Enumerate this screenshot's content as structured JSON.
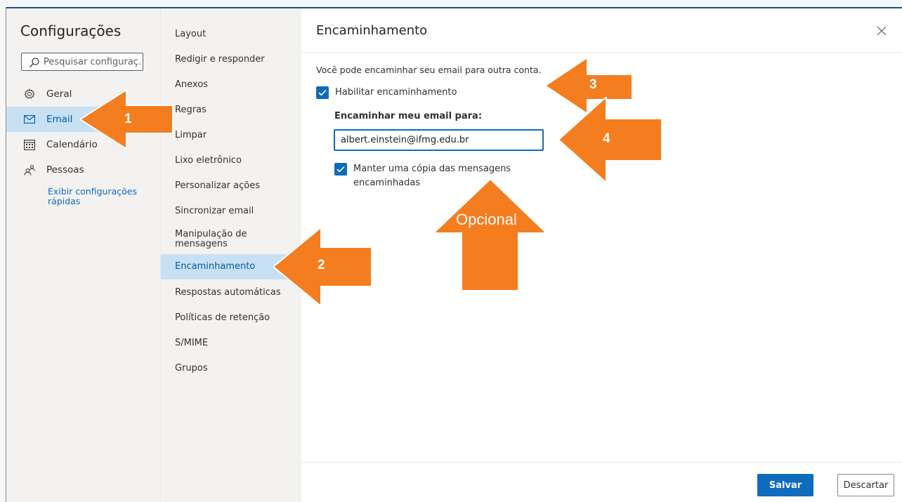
{
  "sidebar": {
    "title": "Configurações",
    "search_placeholder": "Pesquisar configuraç...",
    "items": [
      {
        "label": "Geral",
        "icon": "gear-icon"
      },
      {
        "label": "Email",
        "icon": "mail-icon",
        "active": true
      },
      {
        "label": "Calendário",
        "icon": "calendar-icon"
      },
      {
        "label": "Pessoas",
        "icon": "people-icon"
      }
    ],
    "quick_settings": "Exibir configurações rápidas"
  },
  "submenu": {
    "items": [
      "Layout",
      "Redigir e responder",
      "Anexos",
      "Regras",
      "Limpar",
      "Lixo eletrônico",
      "Personalizar ações",
      "Sincronizar email",
      "Manipulação de mensagens",
      "Encaminhamento",
      "Respostas automáticas",
      "Políticas de retenção",
      "S/MIME",
      "Grupos"
    ],
    "active": "Encaminhamento"
  },
  "panel": {
    "title": "Encaminhamento",
    "description": "Você pode encaminhar seu email para outra conta.",
    "enable_forwarding": {
      "label": "Habilitar encaminhamento",
      "checked": true
    },
    "forward_to_label": "Encaminhar meu email para:",
    "forward_to_value": "albert.einstein@ifmg.edu.br",
    "keep_copy": {
      "label_line1": "Manter uma cópia das mensagens",
      "label_line2": "encaminhadas",
      "checked": true
    },
    "save_label": "Salvar",
    "discard_label": "Descartar"
  },
  "annotations": {
    "arrow_1": "1",
    "arrow_2": "2",
    "arrow_3": "3",
    "arrow_4": "4",
    "arrow_optional": "Opcional",
    "color": "#f47d20"
  }
}
